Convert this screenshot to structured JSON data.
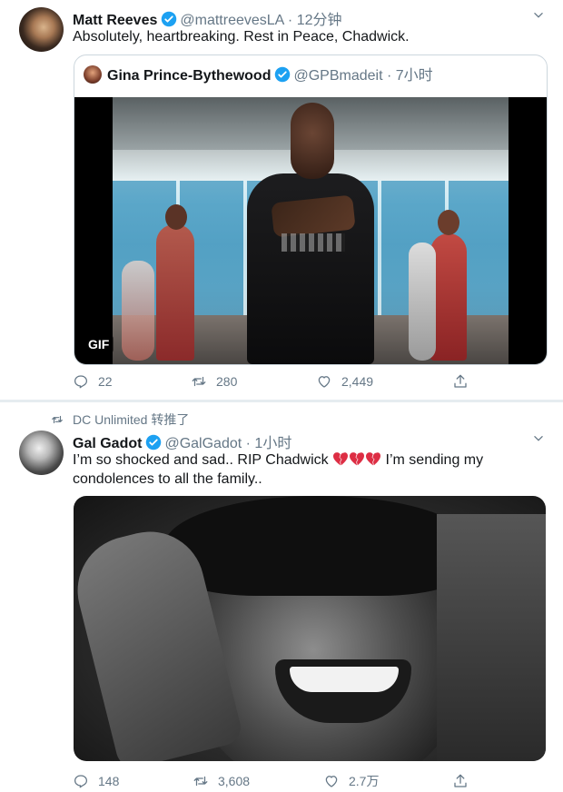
{
  "tweet1": {
    "name": "Matt Reeves",
    "handle": "@mattreevesLA",
    "separator": "·",
    "time": "12分钟",
    "text": "Absolutely, heartbreaking.  Rest in Peace, Chadwick.",
    "quote": {
      "name": "Gina Prince-Bythewood",
      "handle": "@GPBmadeit",
      "separator": "·",
      "time": "7小时",
      "media_badge": "GIF"
    },
    "actions": {
      "replies": "22",
      "retweets": "280",
      "likes": "2,449"
    }
  },
  "retweet_context": {
    "text": "DC Unlimited 转推了"
  },
  "tweet2": {
    "name": "Gal Gadot",
    "handle": "@GalGadot",
    "separator": "·",
    "time": "1小时",
    "text_line1": "I’m so shocked and sad.. RIP Chadwick",
    "text_line1_tail": "I’m sending my",
    "text_line2": "condolences to all the family..",
    "actions": {
      "replies": "148",
      "retweets": "3,608",
      "likes": "2.7万"
    }
  },
  "colors": {
    "verified": "#1da1f2",
    "muted": "#657786",
    "broken_heart": "#dd2e44"
  },
  "icons": [
    "verified-icon",
    "chevron-down-icon",
    "reply-icon",
    "retweet-icon",
    "like-icon",
    "share-icon",
    "broken-heart-icon"
  ]
}
